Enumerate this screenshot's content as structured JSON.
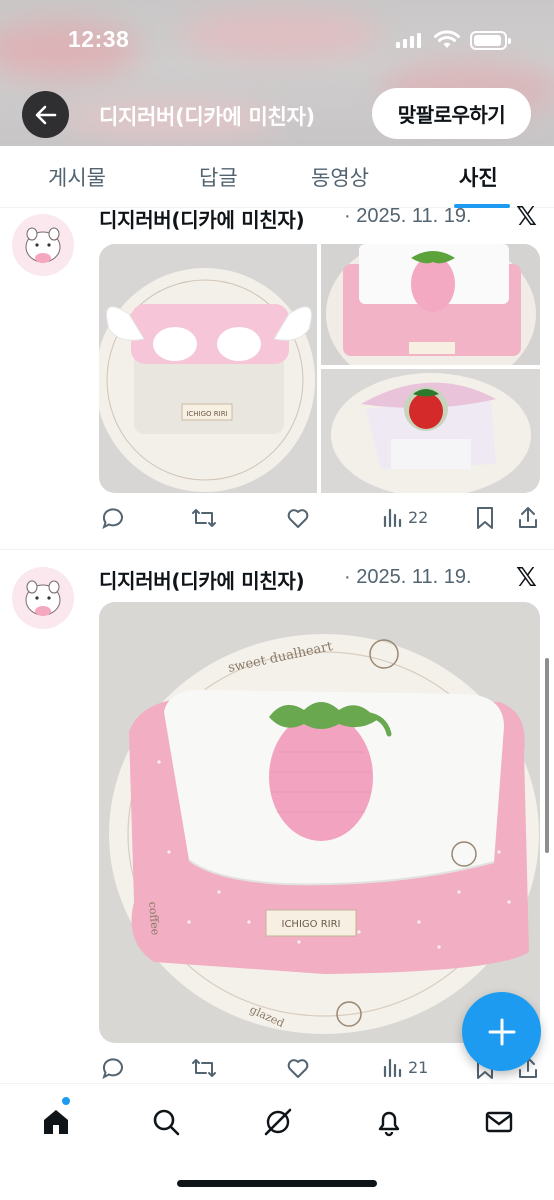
{
  "status_bar": {
    "time": "12:38"
  },
  "header": {
    "back_label": "back",
    "title": "디지러버(디카에 미친자)",
    "follow_button": "맞팔로우하기"
  },
  "tabs": [
    {
      "label": "게시물",
      "active": false
    },
    {
      "label": "답글",
      "active": false
    },
    {
      "label": "동영상",
      "active": false
    },
    {
      "label": "사진",
      "active": true
    }
  ],
  "colors": {
    "accent": "#1d9bf0",
    "secondary_text": "#536471",
    "pink": "#f4b6c8"
  },
  "posts": [
    {
      "author": "디지러버(디카에 미친자)",
      "date": "· 2025. 11. 19.",
      "source_icon": "x-logo-icon",
      "photos": [
        "pink-winged-pouch-photo",
        "strawberry-pouch-photo",
        "strawberry-cake-pouch-photo"
      ],
      "views": "22"
    },
    {
      "author": "디지러버(디카에 미친자)",
      "date": "· 2025. 11. 19.",
      "source_icon": "x-logo-icon",
      "photos": [
        "strawberry-pouch-large-photo"
      ],
      "photo_label": "ICHIGO RIRI",
      "views": "21"
    }
  ],
  "bottom_nav": [
    "home-icon",
    "search-icon",
    "grok-icon",
    "notifications-icon",
    "messages-icon"
  ]
}
